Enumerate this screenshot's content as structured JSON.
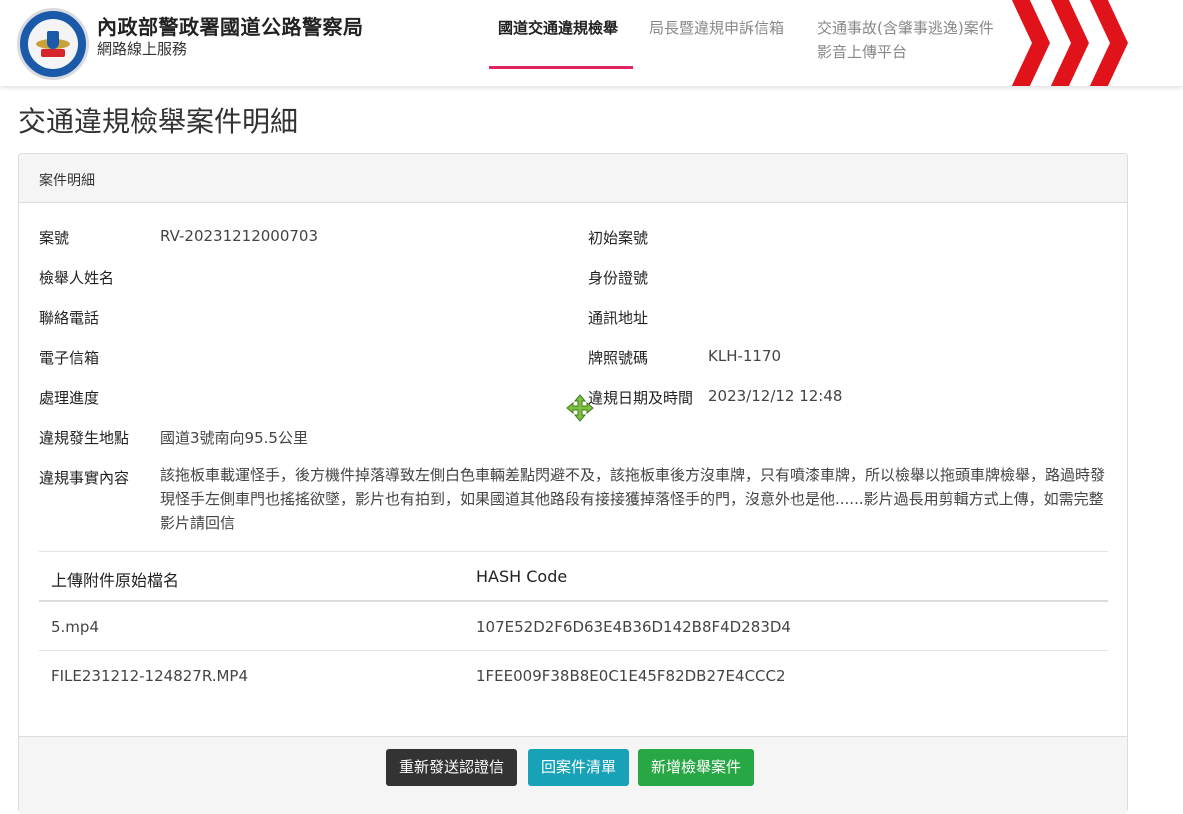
{
  "header": {
    "site_title": "內政部警政署國道公路警察局",
    "site_subtitle": "網路線上服務",
    "nav": [
      {
        "label": "國道交通違規檢舉",
        "active": true
      },
      {
        "label": "局長暨違規申訴信箱",
        "active": false
      },
      {
        "label_line1": "交通事故(含肇事逃逸)案件",
        "label_line2": "影音上傳平台",
        "active": false
      }
    ],
    "accent_color": "#e0245e",
    "chevron_color": "#e1131a"
  },
  "page_title": "交通違規檢舉案件明細",
  "panel": {
    "heading": "案件明細",
    "fields_left": [
      {
        "label": "案號",
        "value": "RV-20231212000703"
      },
      {
        "label": "檢舉人姓名",
        "value": ""
      },
      {
        "label": "聯絡電話",
        "value": ""
      },
      {
        "label": "電子信箱",
        "value": ""
      },
      {
        "label": "處理進度",
        "value": ""
      },
      {
        "label": "違規發生地點",
        "value": "國道3號南向95.5公里"
      }
    ],
    "fields_right": [
      {
        "label": "初始案號",
        "value": ""
      },
      {
        "label": "身份證號",
        "value": ""
      },
      {
        "label": "通訊地址",
        "value": ""
      },
      {
        "label": "牌照號碼",
        "value": "KLH-1170"
      },
      {
        "label": "違規日期及時間",
        "value": "2023/12/12 12:48"
      }
    ],
    "description_label": "違規事實內容",
    "description": "該拖板車載運怪手，後方機件掉落導致左側白色車輛差點閃避不及，該拖板車後方沒車牌，只有噴漆車牌，所以檢舉以拖頭車牌檢舉，路過時發現怪手左側車門也搖搖欲墜，影片也有拍到，如果國道其他路段有接接獲掉落怪手的門，沒意外也是他......影片過長用剪輯方式上傳，如需完整影片請回信",
    "attachments": {
      "headers": [
        "上傳附件原始檔名",
        "HASH Code"
      ],
      "rows": [
        [
          "5.mp4",
          "107E52D2F6D63E4B36D142B8F4D283D4"
        ],
        [
          "FILE231212-124827R.MP4",
          "1FEE009F38B8E0C1E45F82DB27E4CCC2"
        ]
      ]
    }
  },
  "buttons": {
    "resend": "重新發送認證信",
    "back_to_list": "回案件清單",
    "new_report": "新增檢舉案件"
  },
  "cursor": "move-cursor-icon"
}
